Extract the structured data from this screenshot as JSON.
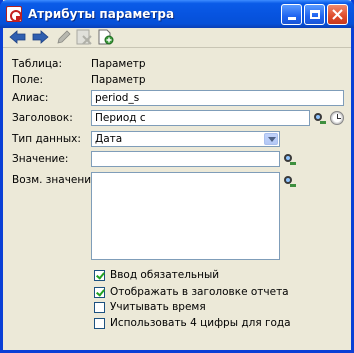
{
  "window": {
    "title": "Атрибуты параметра"
  },
  "icons": {
    "app": "app-icon",
    "back": "arrow-left-icon",
    "forward": "arrow-right-icon",
    "edit": "pencil-icon",
    "delete": "delete-icon",
    "new": "new-document-icon",
    "picker": "picker-icon",
    "clock": "clock-icon"
  },
  "form": {
    "table_label": "Таблица:",
    "table_value": "Параметр",
    "field_label": "Поле:",
    "field_value": "Параметр",
    "alias_label": "Алиас:",
    "alias_value": "period_s",
    "header_label": "Заголовок:",
    "header_value": "Период с",
    "datatype_label": "Тип данных:",
    "datatype_value": "Дата",
    "value_label": "Значение:",
    "value_value": "",
    "possible_label": "Возм. значения:",
    "possible_value": ""
  },
  "checkboxes": [
    {
      "label": "Ввод обязательный",
      "checked": true
    },
    {
      "label": "Отображать в заголовке отчета",
      "checked": true
    },
    {
      "label": "Учитывать время",
      "checked": false
    },
    {
      "label": "Использовать 4 цифры для года",
      "checked": false
    }
  ],
  "colors": {
    "titlebar": "#0754e0",
    "window_bg": "#ece9d8",
    "input_border": "#7f9db9"
  }
}
